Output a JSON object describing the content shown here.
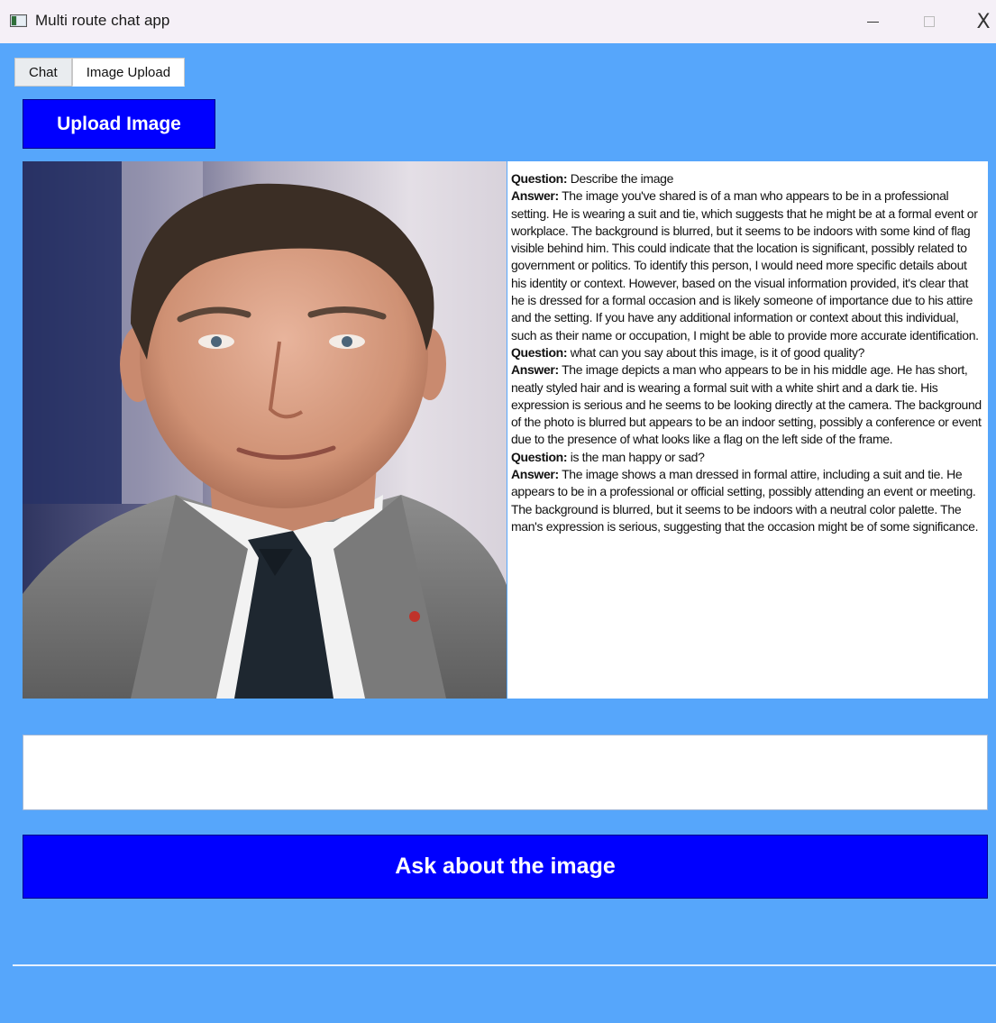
{
  "window": {
    "title": "Multi route chat app",
    "minimize_icon": "minimize-icon",
    "maximize_icon": "maximize-icon",
    "close_glyph": "X"
  },
  "tabs": [
    {
      "label": "Chat",
      "active": false
    },
    {
      "label": "Image Upload",
      "active": true
    }
  ],
  "upload_button": {
    "label": "Upload Image"
  },
  "image": {
    "alt": "Uploaded portrait photo"
  },
  "conversation": [
    {
      "question_label": "Question:",
      "question": "Describe the image",
      "answer_label": "Answer:",
      "answer": "The image you've shared is of a man who appears to be in a professional setting. He is wearing a suit and tie, which suggests that he might be at a formal event or workplace. The background is blurred, but it seems to be indoors with some kind of flag visible behind him. This could indicate that the location is significant, possibly related to government or politics. To identify this person, I would need more specific details about his identity or context. However, based on the visual information provided, it's clear that he is dressed for a formal occasion and is likely someone of importance due to his attire and the setting. If you have any additional information or context about this individual, such as their name or occupation, I might be able to provide more accurate identification."
    },
    {
      "question_label": "Question:",
      "question": "what can you say about this image, is it of good quality?",
      "answer_label": "Answer:",
      "answer": "The image depicts a man who appears to be in his middle age. He has short, neatly styled hair and is wearing a formal suit with a white shirt and a dark tie. His expression is serious and he seems to be looking directly at the camera. The background of the photo is blurred but appears to be an indoor setting, possibly a conference or event due to the presence of what looks like a flag on the left side of the frame."
    },
    {
      "question_label": "Question:",
      "question": "is the man happy or sad?",
      "answer_label": "Answer:",
      "answer": "The image shows a man dressed in formal attire, including a suit and tie. He appears to be in a professional or official setting, possibly attending an event or meeting. The background is blurred, but it seems to be indoors with a neutral color palette. The man's expression is serious, suggesting that the occasion might be of some significance."
    }
  ],
  "question_input": {
    "value": "",
    "placeholder": ""
  },
  "ask_button": {
    "label": "Ask about the image"
  },
  "colors": {
    "background": "#56a6fb",
    "button": "#0000ff",
    "titlebar": "#f5f0f7"
  }
}
